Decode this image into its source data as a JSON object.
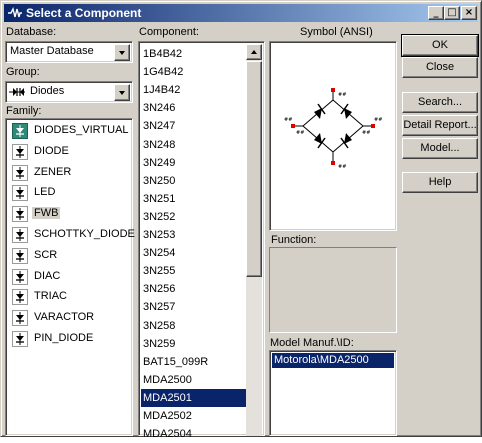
{
  "window": {
    "title": "Select a Component",
    "minimize_glyph": "_",
    "maximize_glyph": "□",
    "close_glyph": "×"
  },
  "database": {
    "label": "Database:",
    "value": "Master Database"
  },
  "group": {
    "label": "Group:",
    "value": "Diodes",
    "icon": "diode-group-icon"
  },
  "family": {
    "label": "Family:",
    "items": [
      {
        "label": "DIODES_VIRTUAL",
        "icon": "virtual-diode-icon"
      },
      {
        "label": "DIODE",
        "icon": "diode-icon"
      },
      {
        "label": "ZENER",
        "icon": "zener-icon"
      },
      {
        "label": "LED",
        "icon": "led-icon"
      },
      {
        "label": "FWB",
        "icon": "bridge-rectifier-icon"
      },
      {
        "label": "SCHOTTKY_DIODE",
        "icon": "schottky-icon"
      },
      {
        "label": "SCR",
        "icon": "scr-icon"
      },
      {
        "label": "DIAC",
        "icon": "diac-icon"
      },
      {
        "label": "TRIAC",
        "icon": "triac-icon"
      },
      {
        "label": "VARACTOR",
        "icon": "varactor-icon"
      },
      {
        "label": "PIN_DIODE",
        "icon": "pin-diode-icon"
      }
    ],
    "selected": "FWB"
  },
  "component": {
    "label": "Component:",
    "items": [
      "1B4B42",
      "1G4B42",
      "1J4B42",
      "3N246",
      "3N247",
      "3N248",
      "3N249",
      "3N250",
      "3N251",
      "3N252",
      "3N253",
      "3N254",
      "3N255",
      "3N256",
      "3N257",
      "3N258",
      "3N259",
      "BAT15_099R",
      "MDA2500",
      "MDA2501",
      "MDA2502",
      "MDA2504"
    ],
    "selected": "MDA2501"
  },
  "symbol": {
    "label": "Symbol (ANSI)"
  },
  "function": {
    "label": "Function:",
    "value": ""
  },
  "model": {
    "label": "Model Manuf.\\ID:",
    "items": [
      "Motorola\\MDA2500"
    ],
    "selected": "Motorola\\MDA2500"
  },
  "buttons": {
    "ok": "OK",
    "close": "Close",
    "search": "Search...",
    "detail_report": "Detail Report...",
    "model": "Model...",
    "help": "Help"
  },
  "colors": {
    "title_start": "#0a246a",
    "title_end": "#a6caf0",
    "selection": "#0a246a",
    "face": "#d4d0c8",
    "pin_red": "#e00000"
  }
}
